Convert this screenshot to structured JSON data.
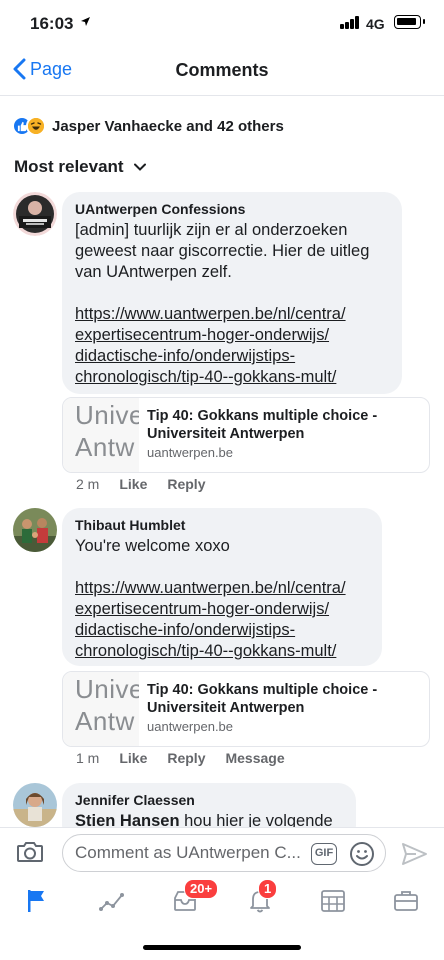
{
  "status": {
    "time": "16:03",
    "network": "4G"
  },
  "nav": {
    "back_label": "Page",
    "title": "Comments"
  },
  "reactions": {
    "summary": "Jasper Vanhaecke and 42 others"
  },
  "sort": {
    "label": "Most relevant"
  },
  "comments": [
    {
      "author": "UAntwerpen Confessions",
      "text": "[admin] tuurlijk zijn er al onderzoeken geweest naar giscorrectie. Hier de uitleg van UAntwerpen zelf.",
      "link_lines": [
        "https://www.uantwerpen.be/nl/centra/",
        "expertisecentrum-hoger-onderwijs/",
        "didactische-info/onderwijstips-",
        "chronologisch/tip-40--gokkans-mult/"
      ],
      "preview": {
        "title": "Tip 40: Gokkans multiple choice - Universiteit Antwerpen",
        "domain": "uantwerpen.be",
        "thumb_line1": "Unive",
        "thumb_line2": "Antw"
      },
      "actions": {
        "time": "2 m",
        "like": "Like",
        "reply": "Reply"
      }
    },
    {
      "author": "Thibaut Humblet",
      "text": "You're welcome xoxo",
      "link_lines": [
        "https://www.uantwerpen.be/nl/centra/",
        "expertisecentrum-hoger-onderwijs/",
        "didactische-info/onderwijstips-",
        "chronologisch/tip-40--gokkans-mult/"
      ],
      "preview": {
        "title": "Tip 40: Gokkans multiple choice - Universiteit Antwerpen",
        "domain": "uantwerpen.be",
        "thumb_line1": "Unive",
        "thumb_line2": "Antw"
      },
      "actions": {
        "time": "1 m",
        "like": "Like",
        "reply": "Reply",
        "message": "Message"
      }
    },
    {
      "author": "Jennifer Claessen",
      "mention": "Stien Hansen",
      "text": "hou hier je volgende"
    }
  ],
  "composer": {
    "placeholder": "Comment as UAntwerpen C...",
    "gif_label": "GIF"
  },
  "tabbar": {
    "badge_marketplace": "20+",
    "badge_notifications": "1"
  },
  "colors": {
    "accent": "#1877f2",
    "badge": "#fa3e3e",
    "bubble": "#f0f2f5"
  }
}
